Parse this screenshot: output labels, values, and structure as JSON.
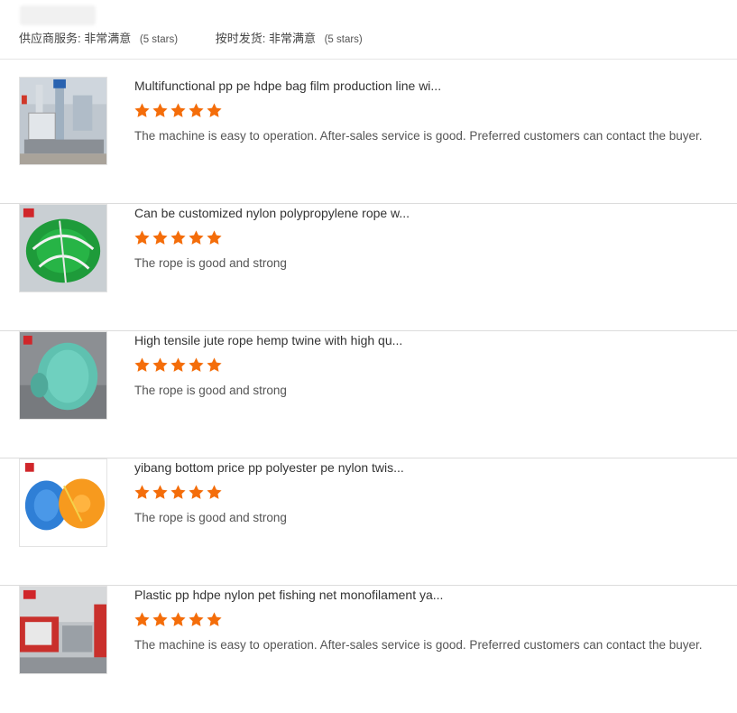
{
  "header": {
    "supplier_service_label": "供应商服务:",
    "supplier_service_value": "非常满意",
    "supplier_service_stars": "(5 stars)",
    "ontime_label": "按时发货:",
    "ontime_value": "非常满意",
    "ontime_stars": "(5 stars)"
  },
  "colors": {
    "star": "#f46d0a",
    "divider": "#dcdcdc"
  },
  "reviews": [
    {
      "title": "Multifunctional pp pe hdpe bag film production line wi...",
      "rating": 5,
      "comment": "The machine is easy to operation. After-sales service is good. Preferred customers can contact the buyer.",
      "image": "machine"
    },
    {
      "title": "Can be customized nylon polypropylene rope w...",
      "rating": 5,
      "comment": "The rope is good and strong",
      "image": "green-rope"
    },
    {
      "title": "High tensile jute rope hemp twine with high qu...",
      "rating": 5,
      "comment": "The rope is good and strong",
      "image": "teal-twine"
    },
    {
      "title": "yibang bottom price pp polyester pe nylon twis...",
      "rating": 5,
      "comment": "The rope is good and strong",
      "image": "blue-orange-rope"
    },
    {
      "title": "Plastic pp hdpe nylon pet fishing net monofilament ya...",
      "rating": 5,
      "comment": "The machine is easy to operation. After-sales service is good. Preferred customers can contact the buyer.",
      "image": "machine-red"
    }
  ]
}
